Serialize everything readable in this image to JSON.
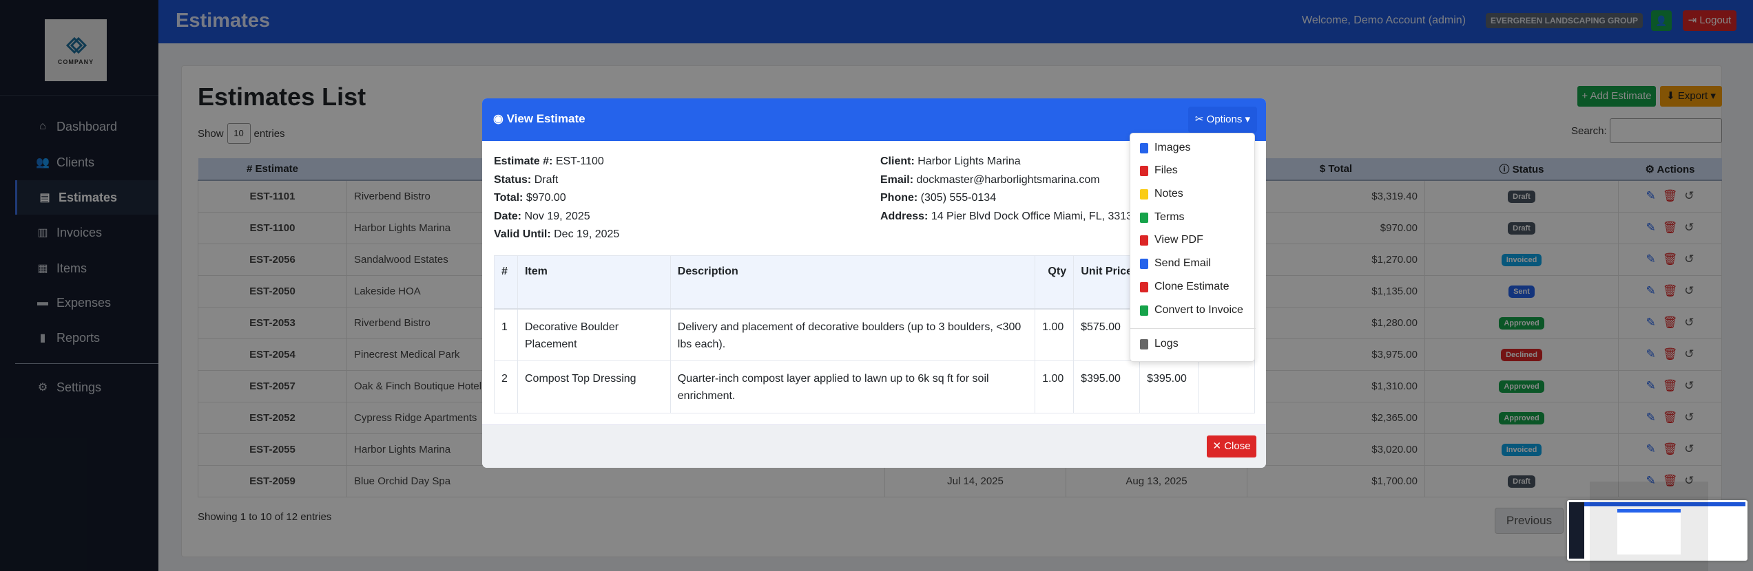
{
  "sidebar": {
    "logo_text": "COMPANY",
    "items": [
      {
        "label": "Dashboard",
        "icon": "home-icon"
      },
      {
        "label": "Clients",
        "icon": "users-icon"
      },
      {
        "label": "Estimates",
        "icon": "file-icon",
        "active": true
      },
      {
        "label": "Invoices",
        "icon": "invoice-icon"
      },
      {
        "label": "Items",
        "icon": "clipboard-icon"
      },
      {
        "label": "Expenses",
        "icon": "wallet-icon"
      },
      {
        "label": "Reports",
        "icon": "chart-icon"
      }
    ],
    "settings": {
      "label": "Settings",
      "icon": "gear-icon"
    }
  },
  "topbar": {
    "title": "Estimates",
    "welcome": "Welcome, Demo Account (admin)",
    "company": "EVERGREEN LANDSCAPING GROUP",
    "logout": "Logout"
  },
  "list": {
    "title": "Estimates List",
    "show_label": "Show",
    "entries_value": "10",
    "entries_label": "entries",
    "add_button": "+ Add Estimate",
    "export_button": "Export",
    "search_label": "Search:",
    "search_value": "",
    "columns": {
      "estimate": "# Estimate",
      "total": "$ Total",
      "status": "Status",
      "actions": "Actions"
    },
    "rows": [
      {
        "estimate": "EST-1101",
        "client": "Riverbend Bistro",
        "total": "$3,319.40",
        "status": "Draft"
      },
      {
        "estimate": "EST-1100",
        "client": "Harbor Lights Marina",
        "total": "$970.00",
        "status": "Draft"
      },
      {
        "estimate": "EST-2056",
        "client": "Sandalwood Estates",
        "total": "$1,270.00",
        "status": "Invoiced"
      },
      {
        "estimate": "EST-2050",
        "client": "Lakeside HOA",
        "total": "$1,135.00",
        "status": "Sent"
      },
      {
        "estimate": "EST-2053",
        "client": "Riverbend Bistro",
        "total": "$1,280.00",
        "status": "Approved"
      },
      {
        "estimate": "EST-2054",
        "client": "Pinecrest Medical Park",
        "total": "$3,975.00",
        "status": "Declined"
      },
      {
        "estimate": "EST-2057",
        "client": "Oak & Finch Boutique Hotel",
        "total": "$1,310.00",
        "status": "Approved"
      },
      {
        "estimate": "EST-2052",
        "client": "Cypress Ridge Apartments",
        "total": "$2,365.00",
        "status": "Approved"
      },
      {
        "estimate": "EST-2055",
        "client": "Harbor Lights Marina",
        "total": "$3,020.00",
        "status": "Invoiced"
      },
      {
        "estimate": "EST-2059",
        "client": "Blue Orchid Day Spa",
        "date": "Jul 14, 2025",
        "valid_until": "Aug 13, 2025",
        "total": "$1,700.00",
        "status": "Draft"
      }
    ],
    "showing": "Showing 1 to 10 of 12 entries",
    "previous": "Previous"
  },
  "status_colors": {
    "Draft": "#4b5563",
    "Invoiced": "#0ea5e9",
    "Sent": "#2563eb",
    "Approved": "#16a34a",
    "Declined": "#dc2626"
  },
  "modal": {
    "title": "View Estimate",
    "options_label": "Options",
    "info_left": [
      {
        "label": "Estimate #:",
        "value": "EST-1100"
      },
      {
        "label": "Status:",
        "value": "Draft"
      },
      {
        "label": "Total:",
        "value": "$970.00"
      },
      {
        "label": "Date:",
        "value": "Nov 19, 2025"
      },
      {
        "label": "Valid Until:",
        "value": "Dec 19, 2025"
      }
    ],
    "info_right": [
      {
        "label": "Client:",
        "value": "Harbor Lights Marina"
      },
      {
        "label": "Email:",
        "value": "dockmaster@harborlightsmarina.com"
      },
      {
        "label": "Phone:",
        "value": "(305) 555-0134"
      },
      {
        "label": "Address:",
        "value": "14 Pier Blvd Dock Office Miami, FL, 3313"
      }
    ],
    "columns": [
      "#",
      "Item",
      "Description",
      "Qty",
      "Unit Price",
      "",
      ""
    ],
    "items": [
      {
        "n": "1",
        "item": "Decorative Boulder Placement",
        "description": "Delivery and placement of decorative boulders (up to 3 boulders, <300 lbs each).",
        "qty": "1.00",
        "unit_price": "$575.00",
        "total": ""
      },
      {
        "n": "2",
        "item": "Compost Top Dressing",
        "description": "Quarter-inch compost layer applied to lawn up to 6k sq ft for soil enrichment.",
        "qty": "1.00",
        "unit_price": "$395.00",
        "total": "$395.00"
      }
    ],
    "close_label": "Close",
    "options_menu": [
      {
        "label": "Images",
        "icon": "image-icon",
        "color": "#2563eb"
      },
      {
        "label": "Files",
        "icon": "pdf-file-icon",
        "color": "#dc2626"
      },
      {
        "label": "Notes",
        "icon": "note-icon",
        "color": "#facc15"
      },
      {
        "label": "Terms",
        "icon": "sheet-icon",
        "color": "#16a34a"
      },
      {
        "label": "View PDF",
        "icon": "pdf-icon",
        "color": "#dc2626"
      },
      {
        "label": "Send Email",
        "icon": "paper-plane-icon",
        "color": "#2563eb"
      },
      {
        "label": "Clone Estimate",
        "icon": "copy-icon",
        "color": "#dc2626"
      },
      {
        "label": "Convert to Invoice",
        "icon": "invoice-icon",
        "color": "#16a34a"
      },
      {
        "label": "Logs",
        "icon": "history-icon",
        "color": "#666666"
      }
    ]
  }
}
